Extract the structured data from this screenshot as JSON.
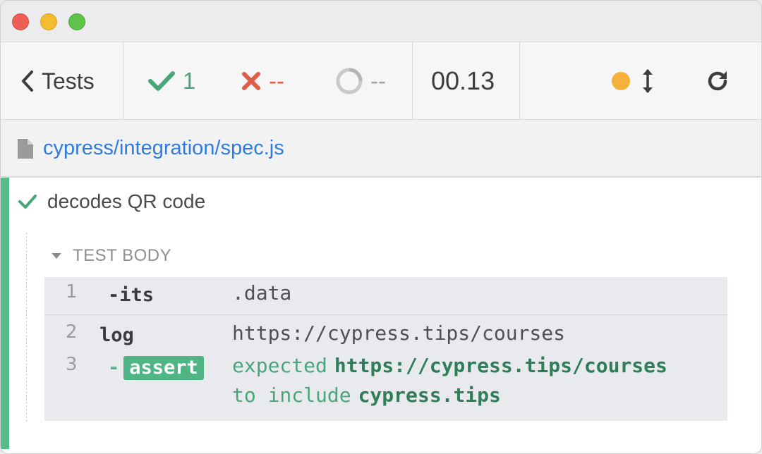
{
  "titlebar": {
    "traffic_lights": [
      "close",
      "minimize",
      "zoom"
    ]
  },
  "header": {
    "back_label": "Tests",
    "passed_count": "1",
    "failed_count": "--",
    "pending_count": "--",
    "duration": "00.13",
    "indicator_color": "#f5b23a"
  },
  "spec": {
    "path": "cypress/integration/spec.js"
  },
  "test": {
    "title": "decodes QR code",
    "state": "passed",
    "hook_title": "TEST BODY",
    "commands": [
      {
        "num": "1",
        "name": "-its",
        "message": ".data"
      },
      {
        "num": "2",
        "name": "log",
        "message": "https://cypress.tips/courses"
      },
      {
        "num": "3",
        "dash": "-",
        "name": "assert",
        "message": {
          "expected_word": "expected",
          "expected_value": "https://cypress.tips/courses",
          "to_include": "to include",
          "include_value": "cypress.tips"
        }
      }
    ]
  },
  "colors": {
    "passed": "#4aa57a",
    "failed": "#e05d4b",
    "pending": "#a3a3a3",
    "link": "#2f7be0",
    "pass_stripe": "#56bc8a"
  }
}
